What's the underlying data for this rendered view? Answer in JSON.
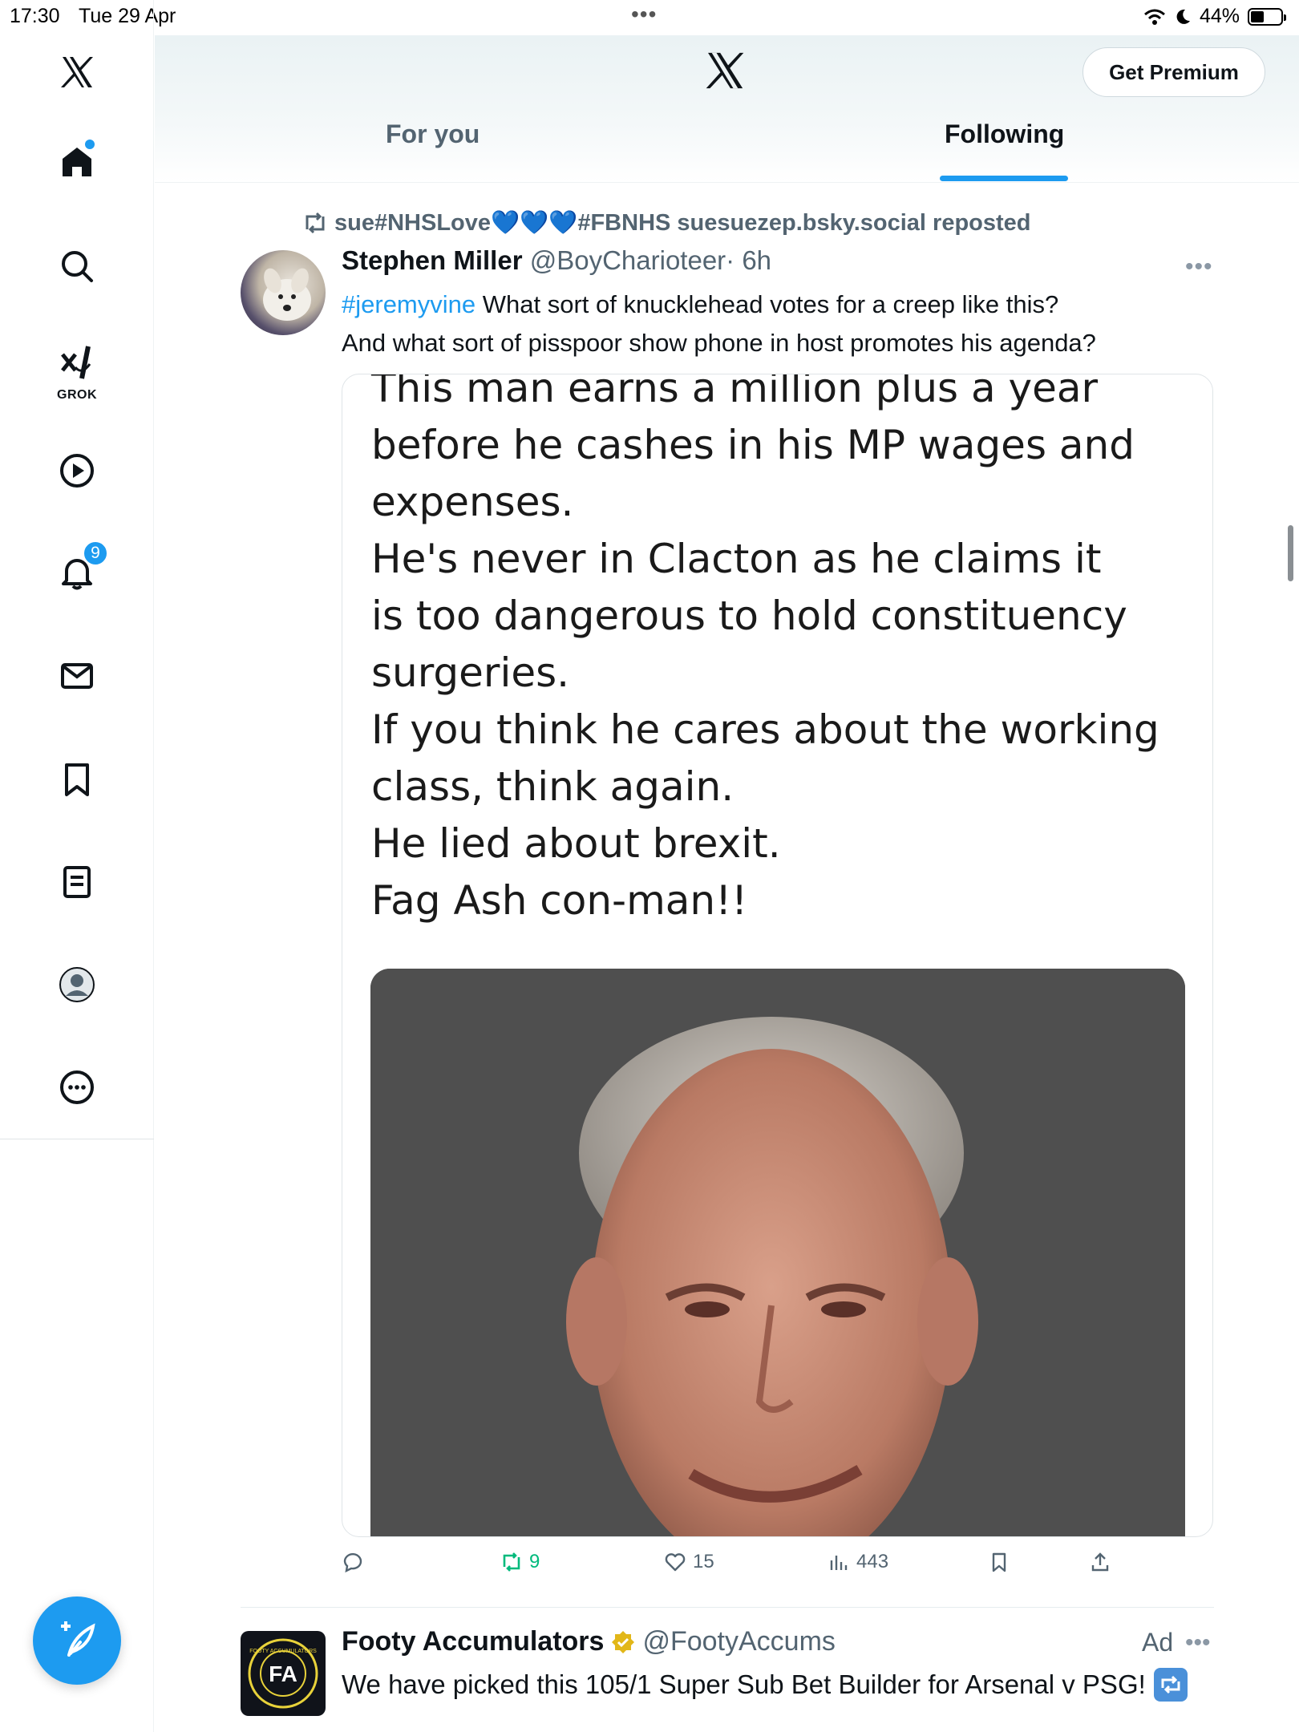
{
  "status_bar": {
    "time": "17:30",
    "date": "Tue 29 Apr",
    "battery": "44%",
    "battery_level": 0.44
  },
  "header": {
    "premium_label": "Get Premium",
    "tabs": [
      {
        "label": "For you",
        "active": false
      },
      {
        "label": "Following",
        "active": true
      }
    ]
  },
  "sidebar": {
    "items": [
      {
        "icon": "x-logo-icon"
      },
      {
        "icon": "home-icon",
        "has_dot": true
      },
      {
        "icon": "search-icon"
      },
      {
        "icon": "grok-icon",
        "label": "GROK"
      },
      {
        "icon": "video-play-icon"
      },
      {
        "icon": "bell-icon",
        "badge": "9"
      },
      {
        "icon": "mail-icon"
      },
      {
        "icon": "bookmark-icon"
      },
      {
        "icon": "list-icon"
      },
      {
        "icon": "profile-icon"
      },
      {
        "icon": "more-circle-icon"
      }
    ],
    "compose_icon": "compose-icon"
  },
  "tweet": {
    "repost_by": "sue#NHSLove💙💙💙#FBNHS suesuezep.bsky.social reposted",
    "author_name": "Stephen Miller",
    "author_handle": "@BoyCharioteer",
    "age": "· 6h",
    "hashtag": "#jeremyvine",
    "text_line1_rest": " What sort of knucklehead votes for a creep like this?",
    "text_line2": "And what sort of pisspoor show phone in host promotes his agenda?",
    "media_text": [
      "This man earns a million plus a year",
      "before he cashes in his MP wages and",
      "expenses.",
      "He's never in Clacton as he claims it",
      "is too dangerous to hold constituency",
      "surgeries.",
      "If you think he cares about the working",
      "class, think again.",
      "He lied about brexit.",
      "Fag Ash con-man!!"
    ],
    "actions": {
      "retweets": "9",
      "likes": "15",
      "views": "443"
    }
  },
  "ad": {
    "author_name": "Footy Accumulators",
    "author_handle": "@FootyAccums",
    "label": "Ad",
    "text": "We have picked this 105/1 Super Sub Bet Builder for Arsenal v PSG!",
    "avatar_ring_text": "FOOTY ACCUMULATORS",
    "avatar_monogram": "FA"
  },
  "colors": {
    "accent": "#1d9bf0",
    "retweet_green": "#00ba7c",
    "muted": "#536471"
  }
}
